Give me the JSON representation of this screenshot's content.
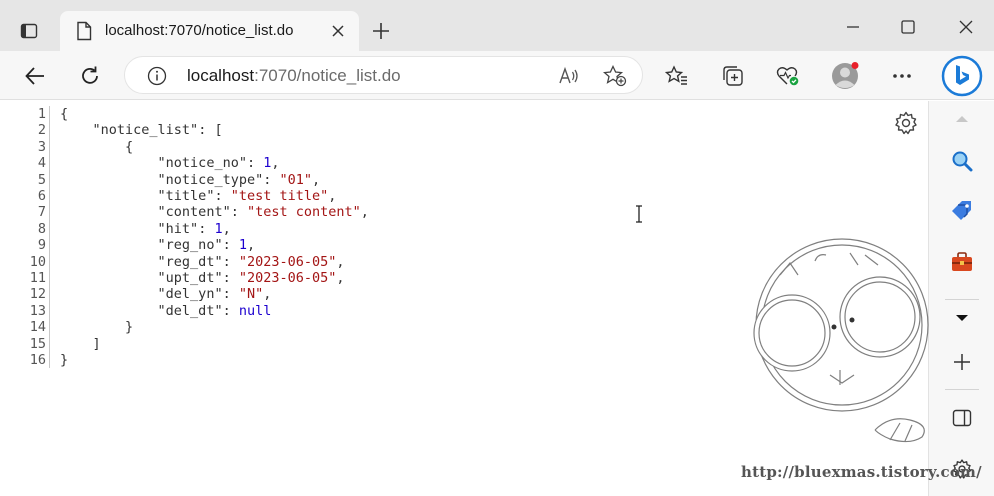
{
  "tab": {
    "title": "localhost:7070/notice_list.do"
  },
  "address": {
    "host": "localhost",
    "rest": ":7070/notice_list.do"
  },
  "json_view": {
    "line_numbers": [
      "1",
      "2",
      "3",
      "4",
      "5",
      "6",
      "7",
      "8",
      "9",
      "10",
      "11",
      "12",
      "13",
      "14",
      "15",
      "16"
    ],
    "lines": [
      [
        {
          "t": "p",
          "v": "{"
        }
      ],
      [
        {
          "t": "p",
          "v": "    "
        },
        {
          "t": "k",
          "v": "\"notice_list\""
        },
        {
          "t": "p",
          "v": ": ["
        }
      ],
      [
        {
          "t": "p",
          "v": "        {"
        }
      ],
      [
        {
          "t": "p",
          "v": "            "
        },
        {
          "t": "k",
          "v": "\"notice_no\""
        },
        {
          "t": "p",
          "v": ": "
        },
        {
          "t": "n",
          "v": "1"
        },
        {
          "t": "p",
          "v": ","
        }
      ],
      [
        {
          "t": "p",
          "v": "            "
        },
        {
          "t": "k",
          "v": "\"notice_type\""
        },
        {
          "t": "p",
          "v": ": "
        },
        {
          "t": "s",
          "v": "\"01\""
        },
        {
          "t": "p",
          "v": ","
        }
      ],
      [
        {
          "t": "p",
          "v": "            "
        },
        {
          "t": "k",
          "v": "\"title\""
        },
        {
          "t": "p",
          "v": ": "
        },
        {
          "t": "s",
          "v": "\"test title\""
        },
        {
          "t": "p",
          "v": ","
        }
      ],
      [
        {
          "t": "p",
          "v": "            "
        },
        {
          "t": "k",
          "v": "\"content\""
        },
        {
          "t": "p",
          "v": ": "
        },
        {
          "t": "s",
          "v": "\"test content\""
        },
        {
          "t": "p",
          "v": ","
        }
      ],
      [
        {
          "t": "p",
          "v": "            "
        },
        {
          "t": "k",
          "v": "\"hit\""
        },
        {
          "t": "p",
          "v": ": "
        },
        {
          "t": "n",
          "v": "1"
        },
        {
          "t": "p",
          "v": ","
        }
      ],
      [
        {
          "t": "p",
          "v": "            "
        },
        {
          "t": "k",
          "v": "\"reg_no\""
        },
        {
          "t": "p",
          "v": ": "
        },
        {
          "t": "n",
          "v": "1"
        },
        {
          "t": "p",
          "v": ","
        }
      ],
      [
        {
          "t": "p",
          "v": "            "
        },
        {
          "t": "k",
          "v": "\"reg_dt\""
        },
        {
          "t": "p",
          "v": ": "
        },
        {
          "t": "s",
          "v": "\"2023-06-05\""
        },
        {
          "t": "p",
          "v": ","
        }
      ],
      [
        {
          "t": "p",
          "v": "            "
        },
        {
          "t": "k",
          "v": "\"upt_dt\""
        },
        {
          "t": "p",
          "v": ": "
        },
        {
          "t": "s",
          "v": "\"2023-06-05\""
        },
        {
          "t": "p",
          "v": ","
        }
      ],
      [
        {
          "t": "p",
          "v": "            "
        },
        {
          "t": "k",
          "v": "\"del_yn\""
        },
        {
          "t": "p",
          "v": ": "
        },
        {
          "t": "s",
          "v": "\"N\""
        },
        {
          "t": "p",
          "v": ","
        }
      ],
      [
        {
          "t": "p",
          "v": "            "
        },
        {
          "t": "k",
          "v": "\"del_dt\""
        },
        {
          "t": "p",
          "v": ": "
        },
        {
          "t": "nl",
          "v": "null"
        }
      ],
      [
        {
          "t": "p",
          "v": "        }"
        }
      ],
      [
        {
          "t": "p",
          "v": "    ]"
        }
      ],
      [
        {
          "t": "p",
          "v": "}"
        }
      ]
    ]
  },
  "watermark": {
    "url": "http://bluexmas.tistory.com/"
  },
  "colors": {
    "accent": "#0f6cbd",
    "string": "#a31515",
    "number": "#1c00cf",
    "profile_dot": "#e8202a"
  },
  "icons": [
    "tab-actions-icon",
    "page-icon",
    "close-icon",
    "plus-icon",
    "minimize-icon",
    "maximize-icon",
    "window-close-icon",
    "back-icon",
    "refresh-icon",
    "info-icon",
    "read-aloud-icon",
    "add-favorite-icon",
    "favorites-icon",
    "collections-icon",
    "browser-essentials-icon",
    "profile-icon",
    "more-icon",
    "bing-icon",
    "gear-icon",
    "search-icon",
    "tag-icon",
    "toolbox-icon",
    "chevron-down-icon",
    "sidebar-icon"
  ]
}
